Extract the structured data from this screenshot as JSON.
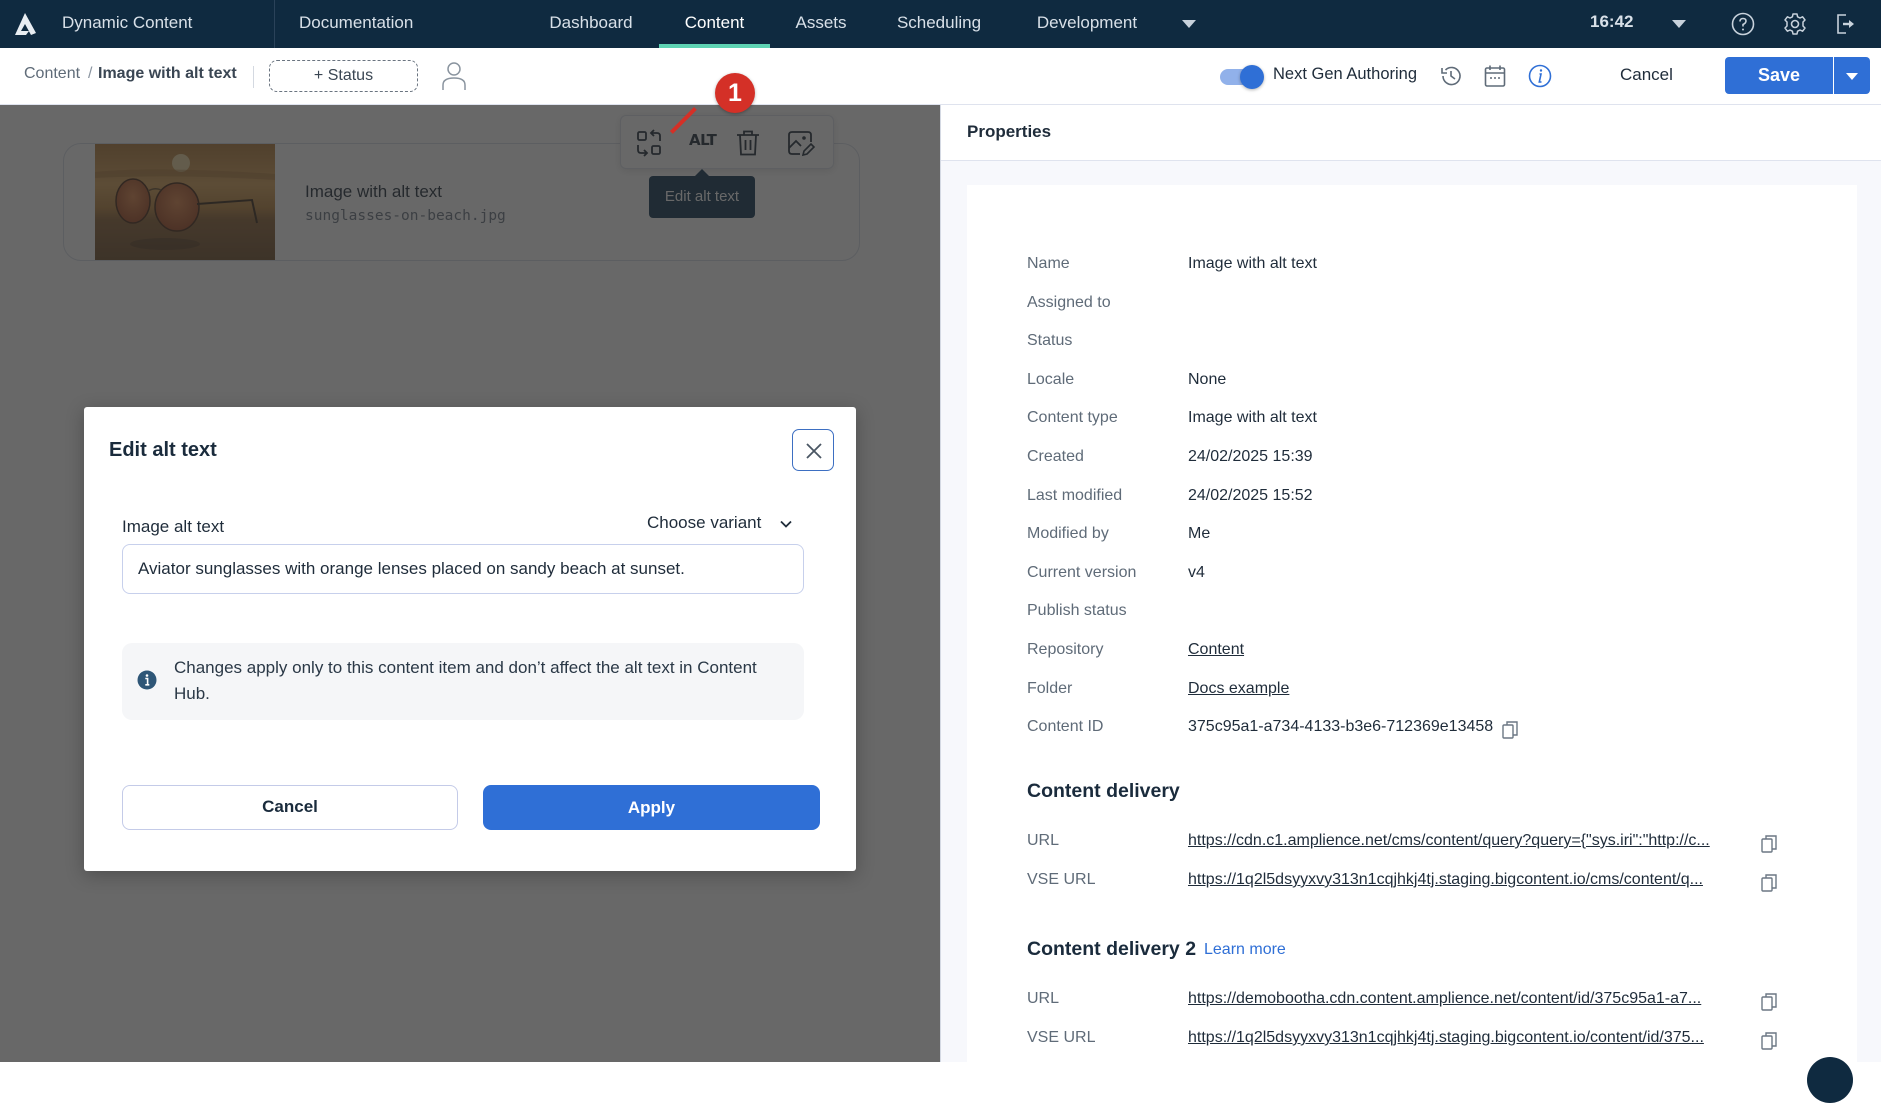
{
  "navbar": {
    "app_name": "Dynamic Content",
    "documentation": "Documentation",
    "tabs": [
      {
        "label": "Dashboard",
        "active": false
      },
      {
        "label": "Content",
        "active": true
      },
      {
        "label": "Assets",
        "active": false
      },
      {
        "label": "Scheduling",
        "active": false
      },
      {
        "label": "Development",
        "active": false
      }
    ],
    "more_icon": "caret-down-icon",
    "time": "16:42",
    "icons": [
      "help-icon",
      "settings-icon",
      "sign-out-icon"
    ]
  },
  "subbar": {
    "breadcrumb_root": "Content",
    "breadcrumb_sep": "/",
    "breadcrumb_current": "Image with alt text",
    "status_button": "+ Status",
    "assignee_icon": "user-icon",
    "toggle_label": "Next Gen Authoring",
    "toggle_on": true,
    "icons": [
      "history-icon",
      "calendar-icon",
      "info-icon"
    ],
    "cancel": "Cancel",
    "save": "Save"
  },
  "canvas": {
    "card": {
      "title": "Image with alt text",
      "filename": "sunglasses-on-beach.jpg",
      "image_alt": "Aviator sunglasses on beach at sunset"
    },
    "toolbar": {
      "icons": [
        "swap-image-icon",
        "alt-text-icon",
        "delete-icon",
        "edit-image-icon"
      ],
      "alt_label": "ALT"
    },
    "tooltip": "Edit alt text",
    "annotation_badge": "1"
  },
  "modal": {
    "title": "Edit alt text",
    "field_label": "Image alt text",
    "variant_label": "Choose variant",
    "alt_text_value": "Aviator sunglasses with orange lenses placed on sandy beach at sunset.",
    "info_text": "Changes apply only to this content item and don’t affect the alt text in Content Hub.",
    "cancel": "Cancel",
    "apply": "Apply"
  },
  "properties": {
    "title": "Properties",
    "rows": [
      {
        "label": "Name",
        "value": "Image with alt text",
        "link": false
      },
      {
        "label": "Assigned to",
        "value": "",
        "link": false
      },
      {
        "label": "Status",
        "value": "",
        "link": false
      },
      {
        "label": "Locale",
        "value": "None",
        "link": false
      },
      {
        "label": "Content type",
        "value": "Image with alt text",
        "link": false
      },
      {
        "label": "Created",
        "value": "24/02/2025 15:39",
        "link": false
      },
      {
        "label": "Last modified",
        "value": "24/02/2025 15:52",
        "link": false
      },
      {
        "label": "Modified by",
        "value": "Me",
        "link": false
      },
      {
        "label": "Current version",
        "value": "v4",
        "link": false
      },
      {
        "label": "Publish status",
        "value": "",
        "link": false
      },
      {
        "label": "Repository",
        "value": "Content",
        "link": true
      },
      {
        "label": "Folder",
        "value": "Docs example",
        "link": true
      },
      {
        "label": "Content ID",
        "value": "375c95a1-a734-4133-b3e6-712369e13458",
        "link": false,
        "copy": true
      }
    ],
    "delivery": {
      "title": "Content delivery",
      "rows": [
        {
          "label": "URL",
          "value": "https://cdn.c1.amplience.net/cms/content/query?query={\"sys.iri\":\"http://c..."
        },
        {
          "label": "VSE URL",
          "value": "https://1q2l5dsyyxvy313n1cqjhkj4tj.staging.bigcontent.io/cms/content/q..."
        }
      ]
    },
    "delivery2": {
      "title": "Content delivery 2",
      "learn_more": "Learn more",
      "rows": [
        {
          "label": "URL",
          "value": "https://demobootha.cdn.content.amplience.net/content/id/375c95a1-a7..."
        },
        {
          "label": "VSE URL",
          "value": "https://1q2l5dsyyxvy313n1cqjhkj4tj.staging.bigcontent.io/content/id/375..."
        }
      ]
    }
  },
  "colors": {
    "navbar_bg": "#0f2a40",
    "active_tab_underline": "#5ed3b3",
    "primary_blue": "#2f6fd6",
    "tooltip_bg": "#0f3552",
    "badge_red": "#d43027"
  }
}
